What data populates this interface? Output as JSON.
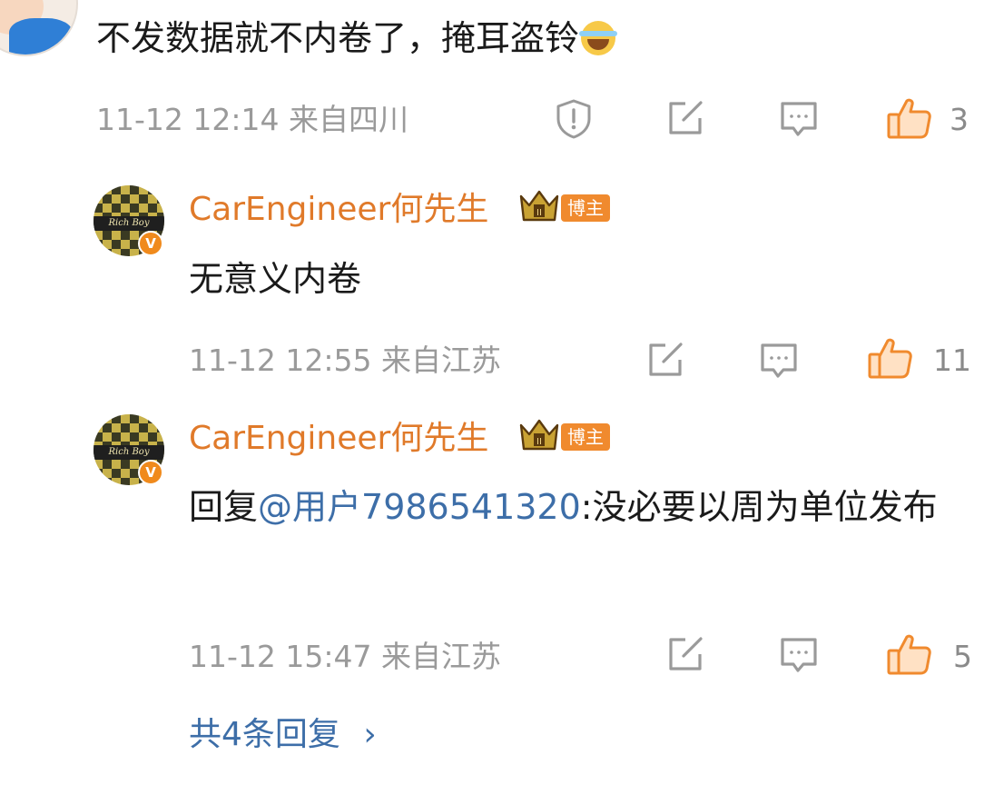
{
  "top_comment": {
    "text": "不发数据就不内卷了，掩耳盗铃",
    "emoji": "laughing-crying-emoji",
    "date": "11-12 12:14",
    "location": "来自四川",
    "likes": "3"
  },
  "replies": [
    {
      "username": "CarEngineer何先生",
      "badge": "博主",
      "avatar_text": "Rich Boy",
      "verified_mark": "V",
      "text": "无意义内卷",
      "date": "11-12 12:55",
      "location": "来自江苏",
      "likes": "11"
    },
    {
      "username": "CarEngineer何先生",
      "badge": "博主",
      "avatar_text": "Rich Boy",
      "verified_mark": "V",
      "reply_prefix": "回复",
      "mention": "@用户7986541320",
      "text": ":没必要以周为单位发布",
      "date": "11-12 15:47",
      "location": "来自江苏",
      "likes": "5"
    }
  ],
  "more_replies": {
    "label": "共4条回复",
    "chevron": "›"
  },
  "colors": {
    "username": "#e07a2a",
    "mention": "#3d6ea8",
    "like_icon": "#f08a2e",
    "meta_text": "#9a9a9a",
    "badge_bg": "#f08a2e"
  }
}
